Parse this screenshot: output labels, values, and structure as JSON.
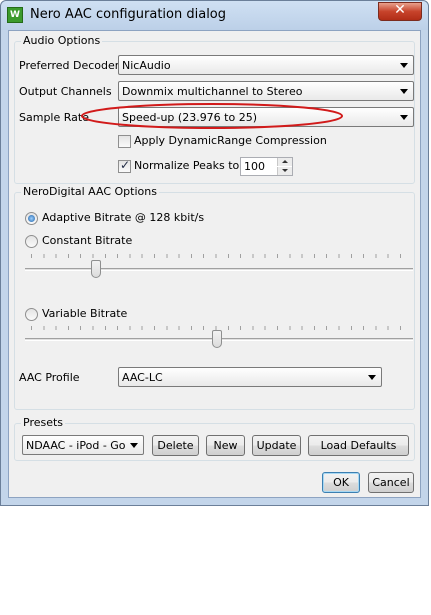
{
  "window": {
    "title": "Nero AAC configuration dialog",
    "app_icon_text": "W",
    "close_glyph": "✕"
  },
  "audio_options": {
    "group_label": "Audio Options",
    "preferred_decoder": {
      "label": "Preferred Decoder",
      "value": "NicAudio"
    },
    "output_channels": {
      "label": "Output Channels",
      "value": "Downmix multichannel to Stereo"
    },
    "sample_rate": {
      "label": "Sample Rate",
      "value": "Speed-up (23.976 to 25)"
    },
    "drc": {
      "label": "Apply DynamicRange Compression",
      "checked": false
    },
    "normalize": {
      "label": "Normalize Peaks to",
      "checked": true,
      "value": "100"
    }
  },
  "nerodigital": {
    "group_label": "NeroDigital AAC Options",
    "adaptive": {
      "label": "Adaptive Bitrate @ 128 kbit/s",
      "selected": true
    },
    "constant": {
      "label": "Constant Bitrate",
      "selected": false,
      "slider_fraction": 0.2
    },
    "variable": {
      "label": "Variable Bitrate",
      "selected": false,
      "slider_fraction": 0.5
    },
    "aac_profile": {
      "label": "AAC Profile",
      "value": "AAC-LC"
    }
  },
  "presets": {
    "group_label": "Presets",
    "selected": "NDAAC - iPod - Gooc",
    "delete_label": "Delete",
    "new_label": "New",
    "update_label": "Update",
    "load_defaults_label": "Load Defaults"
  },
  "footer": {
    "ok_label": "OK",
    "cancel_label": "Cancel"
  },
  "colors": {
    "titlebar": "#c3d5ea",
    "client_bg": "#f0f0f0",
    "close_red": "#c7432b",
    "annotation_ellipse": "#d11a1a"
  }
}
